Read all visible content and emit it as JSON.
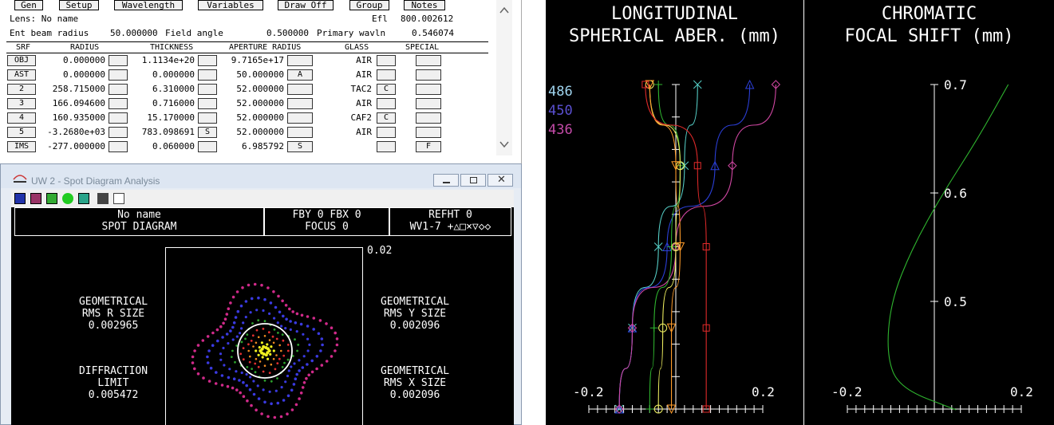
{
  "toolbar": {
    "gen": "Gen",
    "setup": "Setup",
    "wavelength": "Wavelength",
    "variables": "Variables",
    "draw_off": "Draw Off",
    "group": "Group",
    "notes": "Notes"
  },
  "lens": {
    "name_label": "Lens: No name",
    "efl_label": "Efl",
    "efl_value": "800.002612",
    "beam_label": "Ent beam radius",
    "beam_value": "50.000000",
    "field_label": "Field angle",
    "field_value": "0.500000",
    "wavln_label": "Primary wavln",
    "wavln_value": "0.546074"
  },
  "table": {
    "headers": {
      "srf": "SRF",
      "radius": "RADIUS",
      "thickness": "THICKNESS",
      "aperture": "APERTURE RADIUS",
      "glass": "GLASS",
      "special": "SPECIAL"
    },
    "rows": [
      {
        "srf": "OBJ",
        "radius": "0.000000",
        "thickness": "1.1134e+20",
        "aperture": "9.7165e+17",
        "glass": "AIR",
        "r_flag": "",
        "t_flag": "",
        "a_flag": "",
        "g_flag": "",
        "special": ""
      },
      {
        "srf": "AST",
        "radius": "0.000000",
        "thickness": "0.000000",
        "aperture": "50.000000",
        "glass": "AIR",
        "r_flag": "",
        "t_flag": "",
        "a_flag": "A",
        "g_flag": "",
        "special": ""
      },
      {
        "srf": "2",
        "radius": "258.715000",
        "thickness": "6.310000",
        "aperture": "52.000000",
        "glass": "TAC2",
        "r_flag": "",
        "t_flag": "",
        "a_flag": "",
        "g_flag": "C",
        "special": ""
      },
      {
        "srf": "3",
        "radius": "166.094600",
        "thickness": "0.716000",
        "aperture": "52.000000",
        "glass": "AIR",
        "r_flag": "",
        "t_flag": "",
        "a_flag": "",
        "g_flag": "",
        "special": ""
      },
      {
        "srf": "4",
        "radius": "160.935000",
        "thickness": "15.170000",
        "aperture": "52.000000",
        "glass": "CAF2",
        "r_flag": "",
        "t_flag": "",
        "a_flag": "",
        "g_flag": "C",
        "special": ""
      },
      {
        "srf": "5",
        "radius": "-3.2680e+03",
        "thickness": "783.098691",
        "aperture": "52.000000",
        "glass": "AIR",
        "r_flag": "",
        "t_flag": "S",
        "a_flag": "",
        "g_flag": "",
        "special": ""
      },
      {
        "srf": "IMS",
        "radius": "-277.000000",
        "thickness": "0.060000",
        "aperture": "6.985792",
        "glass": "",
        "r_flag": "",
        "t_flag": "",
        "a_flag": "S",
        "g_flag": "",
        "special": "F"
      }
    ]
  },
  "spot_window": {
    "title": "UW 2 - Spot Diagram Analysis",
    "header_left_1": "No name",
    "header_left_2": "SPOT DIAGRAM",
    "header_mid_1": "FBY 0 FBX 0",
    "header_mid_2": "FOCUS 0",
    "header_right_1": "REFHT 0",
    "header_right_2": "WV1-7 +△□×▽◇◇",
    "scale": "0.02",
    "rms_r": {
      "l1": "GEOMETRICAL",
      "l2": "RMS R SIZE",
      "value": "0.002965"
    },
    "rms_y": {
      "l1": "GEOMETRICAL",
      "l2": "RMS Y SIZE",
      "value": "0.002096"
    },
    "diff": {
      "l1": "DIFFRACTION",
      "l2": "LIMIT",
      "value": "0.005472"
    },
    "rms_x": {
      "l1": "GEOMETRICAL",
      "l2": "RMS X SIZE",
      "value": "0.002096"
    }
  },
  "chart_data": [
    {
      "type": "line",
      "title": "LONGITUDINAL SPHERICAL ABER. (mm)",
      "xlim": [
        -0.2,
        0.2
      ],
      "x_ticks": [
        "-0.2",
        "0.2"
      ],
      "legend": [
        {
          "name": "486",
          "color": "#9fd4ee"
        },
        {
          "name": "450",
          "color": "#5a4fd0"
        },
        {
          "name": "436",
          "color": "#c44ba8"
        }
      ],
      "series": [
        {
          "name": "486",
          "color": "#56d0c8",
          "marker": "x",
          "points": [
            [
              0.05,
              1.0
            ],
            [
              0.02,
              0.75
            ],
            [
              -0.04,
              0.5
            ],
            [
              -0.1,
              0.25
            ],
            [
              -0.13,
              0.0
            ]
          ]
        },
        {
          "name": "450",
          "color": "#2b3fd8",
          "marker": "triangle",
          "points": [
            [
              0.17,
              1.0
            ],
            [
              0.09,
              0.75
            ],
            [
              -0.02,
              0.5
            ],
            [
              -0.1,
              0.25
            ],
            [
              -0.13,
              0.0
            ]
          ]
        },
        {
          "name": "436",
          "color": "#d047a2",
          "marker": "diamond",
          "points": [
            [
              0.23,
              1.0
            ],
            [
              0.13,
              0.75
            ],
            [
              0.0,
              0.5
            ],
            [
              -0.1,
              0.25
            ],
            [
              -0.13,
              0.0
            ]
          ]
        },
        {
          "name": "green",
          "color": "#2fb52f",
          "marker": "plus",
          "points": [
            [
              -0.04,
              1.0
            ],
            [
              0.01,
              0.75
            ],
            [
              -0.01,
              0.5
            ],
            [
              -0.05,
              0.25
            ],
            [
              -0.06,
              0.0
            ]
          ]
        },
        {
          "name": "yellow",
          "color": "#f0f060",
          "marker": "circle",
          "points": [
            [
              -0.06,
              1.0
            ],
            [
              0.01,
              0.75
            ],
            [
              0.0,
              0.5
            ],
            [
              -0.03,
              0.25
            ],
            [
              -0.04,
              0.0
            ]
          ]
        },
        {
          "name": "orange",
          "color": "#ff9c2a",
          "marker": "triangle-down",
          "points": [
            [
              -0.06,
              1.0
            ],
            [
              0.0,
              0.75
            ],
            [
              0.01,
              0.5
            ],
            [
              -0.01,
              0.25
            ],
            [
              -0.01,
              0.0
            ]
          ]
        },
        {
          "name": "red",
          "color": "#e02a2a",
          "marker": "square",
          "points": [
            [
              -0.07,
              1.0
            ],
            [
              0.05,
              0.75
            ],
            [
              0.07,
              0.5
            ],
            [
              0.07,
              0.25
            ],
            [
              0.07,
              0.0
            ]
          ]
        }
      ]
    },
    {
      "type": "line",
      "title": "CHROMATIC FOCAL SHIFT (mm)",
      "xlim": [
        -0.2,
        0.2
      ],
      "x_ticks": [
        "-0.2",
        "0.2"
      ],
      "y_ticks": [
        "0.7",
        "0.6",
        "0.5"
      ],
      "series": [
        {
          "name": "focal shift",
          "color": "#2fb52f",
          "points": [
            [
              0.17,
              0.7
            ],
            [
              0.1,
              0.65
            ],
            [
              0.02,
              0.6
            ],
            [
              -0.05,
              0.55
            ],
            [
              -0.1,
              0.5
            ],
            [
              -0.11,
              0.45
            ],
            [
              -0.08,
              0.42
            ],
            [
              0.05,
              0.4
            ]
          ]
        }
      ]
    }
  ]
}
